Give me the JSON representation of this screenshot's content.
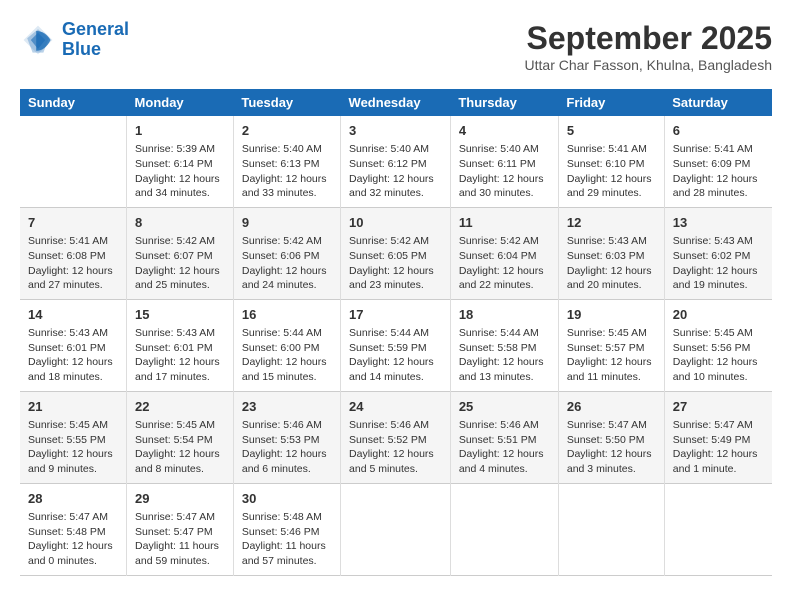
{
  "header": {
    "logo_line1": "General",
    "logo_line2": "Blue",
    "month": "September 2025",
    "location": "Uttar Char Fasson, Khulna, Bangladesh"
  },
  "weekdays": [
    "Sunday",
    "Monday",
    "Tuesday",
    "Wednesday",
    "Thursday",
    "Friday",
    "Saturday"
  ],
  "rows": [
    [
      {
        "day": "",
        "info": ""
      },
      {
        "day": "1",
        "info": "Sunrise: 5:39 AM\nSunset: 6:14 PM\nDaylight: 12 hours\nand 34 minutes."
      },
      {
        "day": "2",
        "info": "Sunrise: 5:40 AM\nSunset: 6:13 PM\nDaylight: 12 hours\nand 33 minutes."
      },
      {
        "day": "3",
        "info": "Sunrise: 5:40 AM\nSunset: 6:12 PM\nDaylight: 12 hours\nand 32 minutes."
      },
      {
        "day": "4",
        "info": "Sunrise: 5:40 AM\nSunset: 6:11 PM\nDaylight: 12 hours\nand 30 minutes."
      },
      {
        "day": "5",
        "info": "Sunrise: 5:41 AM\nSunset: 6:10 PM\nDaylight: 12 hours\nand 29 minutes."
      },
      {
        "day": "6",
        "info": "Sunrise: 5:41 AM\nSunset: 6:09 PM\nDaylight: 12 hours\nand 28 minutes."
      }
    ],
    [
      {
        "day": "7",
        "info": "Sunrise: 5:41 AM\nSunset: 6:08 PM\nDaylight: 12 hours\nand 27 minutes."
      },
      {
        "day": "8",
        "info": "Sunrise: 5:42 AM\nSunset: 6:07 PM\nDaylight: 12 hours\nand 25 minutes."
      },
      {
        "day": "9",
        "info": "Sunrise: 5:42 AM\nSunset: 6:06 PM\nDaylight: 12 hours\nand 24 minutes."
      },
      {
        "day": "10",
        "info": "Sunrise: 5:42 AM\nSunset: 6:05 PM\nDaylight: 12 hours\nand 23 minutes."
      },
      {
        "day": "11",
        "info": "Sunrise: 5:42 AM\nSunset: 6:04 PM\nDaylight: 12 hours\nand 22 minutes."
      },
      {
        "day": "12",
        "info": "Sunrise: 5:43 AM\nSunset: 6:03 PM\nDaylight: 12 hours\nand 20 minutes."
      },
      {
        "day": "13",
        "info": "Sunrise: 5:43 AM\nSunset: 6:02 PM\nDaylight: 12 hours\nand 19 minutes."
      }
    ],
    [
      {
        "day": "14",
        "info": "Sunrise: 5:43 AM\nSunset: 6:01 PM\nDaylight: 12 hours\nand 18 minutes."
      },
      {
        "day": "15",
        "info": "Sunrise: 5:43 AM\nSunset: 6:01 PM\nDaylight: 12 hours\nand 17 minutes."
      },
      {
        "day": "16",
        "info": "Sunrise: 5:44 AM\nSunset: 6:00 PM\nDaylight: 12 hours\nand 15 minutes."
      },
      {
        "day": "17",
        "info": "Sunrise: 5:44 AM\nSunset: 5:59 PM\nDaylight: 12 hours\nand 14 minutes."
      },
      {
        "day": "18",
        "info": "Sunrise: 5:44 AM\nSunset: 5:58 PM\nDaylight: 12 hours\nand 13 minutes."
      },
      {
        "day": "19",
        "info": "Sunrise: 5:45 AM\nSunset: 5:57 PM\nDaylight: 12 hours\nand 11 minutes."
      },
      {
        "day": "20",
        "info": "Sunrise: 5:45 AM\nSunset: 5:56 PM\nDaylight: 12 hours\nand 10 minutes."
      }
    ],
    [
      {
        "day": "21",
        "info": "Sunrise: 5:45 AM\nSunset: 5:55 PM\nDaylight: 12 hours\nand 9 minutes."
      },
      {
        "day": "22",
        "info": "Sunrise: 5:45 AM\nSunset: 5:54 PM\nDaylight: 12 hours\nand 8 minutes."
      },
      {
        "day": "23",
        "info": "Sunrise: 5:46 AM\nSunset: 5:53 PM\nDaylight: 12 hours\nand 6 minutes."
      },
      {
        "day": "24",
        "info": "Sunrise: 5:46 AM\nSunset: 5:52 PM\nDaylight: 12 hours\nand 5 minutes."
      },
      {
        "day": "25",
        "info": "Sunrise: 5:46 AM\nSunset: 5:51 PM\nDaylight: 12 hours\nand 4 minutes."
      },
      {
        "day": "26",
        "info": "Sunrise: 5:47 AM\nSunset: 5:50 PM\nDaylight: 12 hours\nand 3 minutes."
      },
      {
        "day": "27",
        "info": "Sunrise: 5:47 AM\nSunset: 5:49 PM\nDaylight: 12 hours\nand 1 minute."
      }
    ],
    [
      {
        "day": "28",
        "info": "Sunrise: 5:47 AM\nSunset: 5:48 PM\nDaylight: 12 hours\nand 0 minutes."
      },
      {
        "day": "29",
        "info": "Sunrise: 5:47 AM\nSunset: 5:47 PM\nDaylight: 11 hours\nand 59 minutes."
      },
      {
        "day": "30",
        "info": "Sunrise: 5:48 AM\nSunset: 5:46 PM\nDaylight: 11 hours\nand 57 minutes."
      },
      {
        "day": "",
        "info": ""
      },
      {
        "day": "",
        "info": ""
      },
      {
        "day": "",
        "info": ""
      },
      {
        "day": "",
        "info": ""
      }
    ]
  ]
}
